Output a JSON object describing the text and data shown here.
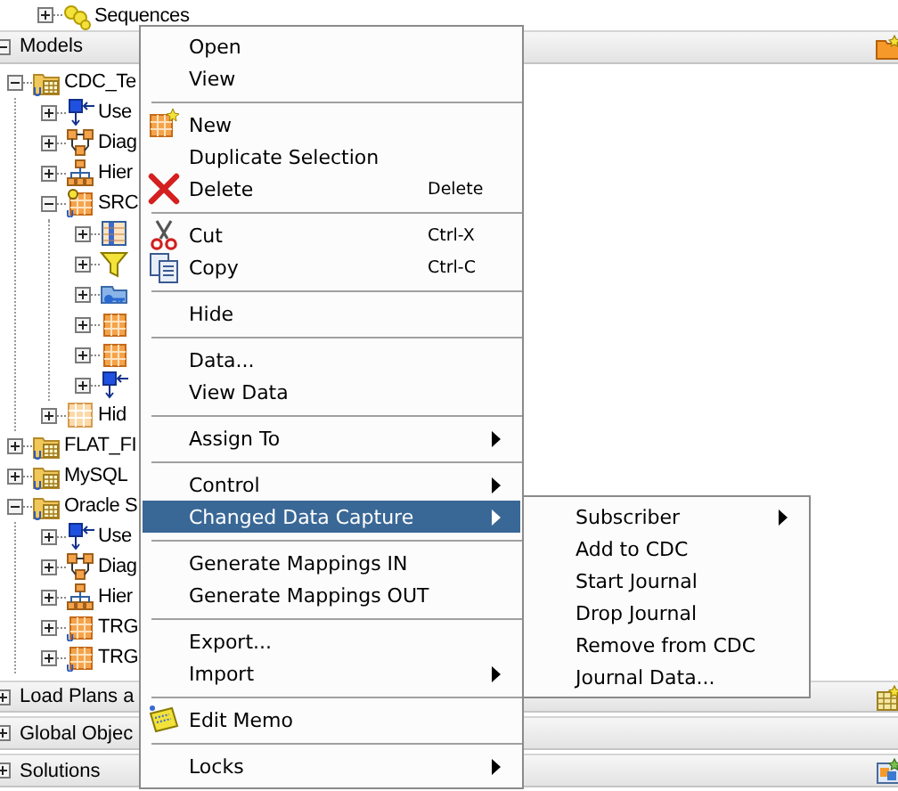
{
  "tree": {
    "top_rows": [
      {
        "label": "Sequences",
        "kind": "sequence",
        "expanded": false
      }
    ],
    "sections": [
      {
        "title": "Models",
        "expanded": true,
        "kind": "folder",
        "rows": [
          {
            "label": "CDC_Te",
            "kind": "model",
            "expanded": true,
            "children": [
              {
                "label": "Use",
                "kind": "users",
                "expanded": false
              },
              {
                "label": "Diag",
                "kind": "diagram",
                "expanded": false
              },
              {
                "label": "Hier",
                "kind": "hierarchy",
                "expanded": false
              },
              {
                "label": "SRC",
                "kind": "datastore-clock",
                "expanded": true,
                "children": [
                  {
                    "kind": "columns",
                    "expanded": false
                  },
                  {
                    "kind": "filter",
                    "expanded": false
                  },
                  {
                    "kind": "keys",
                    "expanded": false
                  },
                  {
                    "kind": "datastore",
                    "expanded": false
                  },
                  {
                    "kind": "datastore",
                    "expanded": false
                  },
                  {
                    "kind": "users",
                    "expanded": false
                  }
                ]
              },
              {
                "label": "Hid",
                "kind": "grid",
                "expanded": false
              }
            ]
          },
          {
            "label": "FLAT_FI",
            "kind": "model",
            "expanded": false
          },
          {
            "label": "MySQL",
            "kind": "model",
            "expanded": false
          },
          {
            "label": "Oracle S",
            "kind": "model",
            "expanded": true,
            "children": [
              {
                "label": "Use",
                "kind": "users",
                "expanded": false
              },
              {
                "label": "Diag",
                "kind": "diagram",
                "expanded": false
              },
              {
                "label": "Hier",
                "kind": "hierarchy",
                "expanded": false
              },
              {
                "label": "TRG",
                "kind": "datastore-u",
                "expanded": false
              },
              {
                "label": "TRG",
                "kind": "datastore-u",
                "expanded": false
              }
            ]
          }
        ]
      },
      {
        "title": "Load Plans a",
        "expanded": false,
        "kind": "table"
      },
      {
        "title": "Global Objec",
        "expanded": false,
        "kind": "plain"
      },
      {
        "title": "Solutions",
        "expanded": false,
        "kind": "window"
      }
    ]
  },
  "context_menu": {
    "items": [
      {
        "kind": "item",
        "label": "Open",
        "selected": false,
        "submenu": false
      },
      {
        "kind": "item",
        "label": "View",
        "selected": false,
        "submenu": false
      },
      {
        "kind": "separator"
      },
      {
        "kind": "new",
        "label": "New",
        "selected": false,
        "submenu": false
      },
      {
        "kind": "item",
        "label": "Duplicate Selection",
        "selected": false,
        "submenu": false
      },
      {
        "kind": "delete",
        "label": "Delete",
        "shortcut": "Delete",
        "selected": false,
        "submenu": false
      },
      {
        "kind": "separator"
      },
      {
        "kind": "cut",
        "label": "Cut",
        "shortcut": "Ctrl-X",
        "selected": false,
        "submenu": false
      },
      {
        "kind": "copy",
        "label": "Copy",
        "shortcut": "Ctrl-C",
        "selected": false,
        "submenu": false
      },
      {
        "kind": "separator"
      },
      {
        "kind": "item",
        "label": "Hide",
        "selected": false,
        "submenu": false
      },
      {
        "kind": "separator"
      },
      {
        "kind": "item",
        "label": "Data...",
        "selected": false,
        "submenu": false
      },
      {
        "kind": "item",
        "label": "View Data",
        "selected": false,
        "submenu": false
      },
      {
        "kind": "separator"
      },
      {
        "kind": "item",
        "label": "Assign To",
        "selected": false,
        "submenu": true
      },
      {
        "kind": "separator"
      },
      {
        "kind": "item",
        "label": "Control",
        "selected": false,
        "submenu": true
      },
      {
        "kind": "item",
        "label": "Changed Data Capture",
        "selected": true,
        "submenu": true
      },
      {
        "kind": "separator"
      },
      {
        "kind": "item",
        "label": "Generate Mappings IN",
        "selected": false,
        "submenu": false
      },
      {
        "kind": "item",
        "label": "Generate Mappings OUT",
        "selected": false,
        "submenu": false
      },
      {
        "kind": "separator"
      },
      {
        "kind": "item",
        "label": "Export...",
        "selected": false,
        "submenu": false
      },
      {
        "kind": "item",
        "label": "Import",
        "selected": false,
        "submenu": true
      },
      {
        "kind": "separator"
      },
      {
        "kind": "memo",
        "label": "Edit Memo",
        "selected": false,
        "submenu": false
      },
      {
        "kind": "separator"
      },
      {
        "kind": "item",
        "label": "Locks",
        "selected": false,
        "submenu": true
      }
    ]
  },
  "submenu": {
    "items": [
      {
        "kind": "item",
        "label": "Subscriber",
        "selected": false,
        "submenu": true
      },
      {
        "kind": "item",
        "label": "Add to CDC",
        "selected": false,
        "submenu": false
      },
      {
        "kind": "item",
        "label": "Start Journal",
        "selected": false,
        "submenu": false
      },
      {
        "kind": "item",
        "label": "Drop Journal",
        "selected": false,
        "submenu": false
      },
      {
        "kind": "item",
        "label": "Remove from CDC",
        "selected": false,
        "submenu": false
      },
      {
        "kind": "item",
        "label": "Journal Data...",
        "selected": false,
        "submenu": false
      }
    ]
  }
}
